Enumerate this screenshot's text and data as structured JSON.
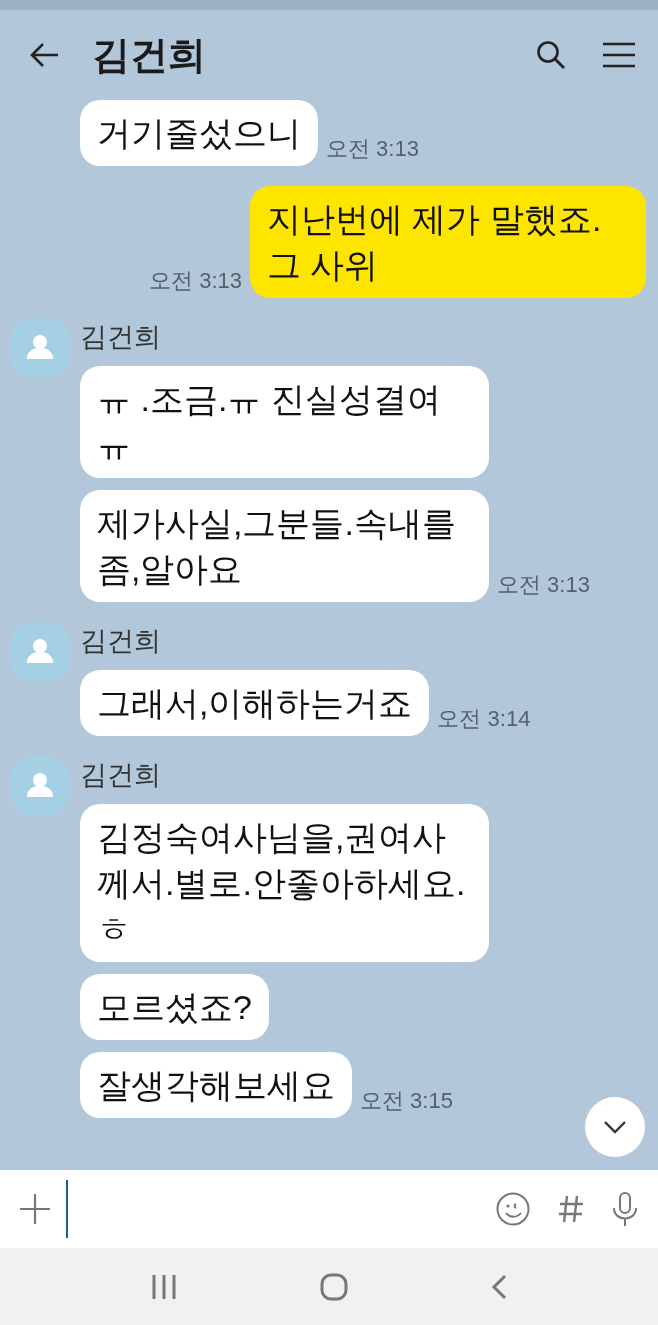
{
  "header": {
    "title": "김건희"
  },
  "messages": [
    {
      "kind": "received",
      "bubbles": [
        "거기줄섰으니"
      ],
      "time": "오전 3:13"
    },
    {
      "kind": "sent",
      "bubbles": [
        "지난번에 제가 말했죠. 그 사위"
      ],
      "time": "오전 3:13"
    },
    {
      "kind": "received",
      "sender": "김건희",
      "bubbles": [
        "ㅠ .조금.ㅠ 진실성결여 ㅠ",
        "제가사실,그분들.속내를 좀,알아요"
      ],
      "time": "오전 3:13"
    },
    {
      "kind": "received",
      "sender": "김건희",
      "bubbles": [
        "그래서,이해하는거죠"
      ],
      "time": "오전 3:14"
    },
    {
      "kind": "received",
      "sender": "김건희",
      "bubbles": [
        "김정숙여사님을,권여사께서.별로.안좋아하세요.ㅎ",
        "모르셨죠?",
        "잘생각해보세요"
      ],
      "time": "오전 3:15"
    }
  ]
}
